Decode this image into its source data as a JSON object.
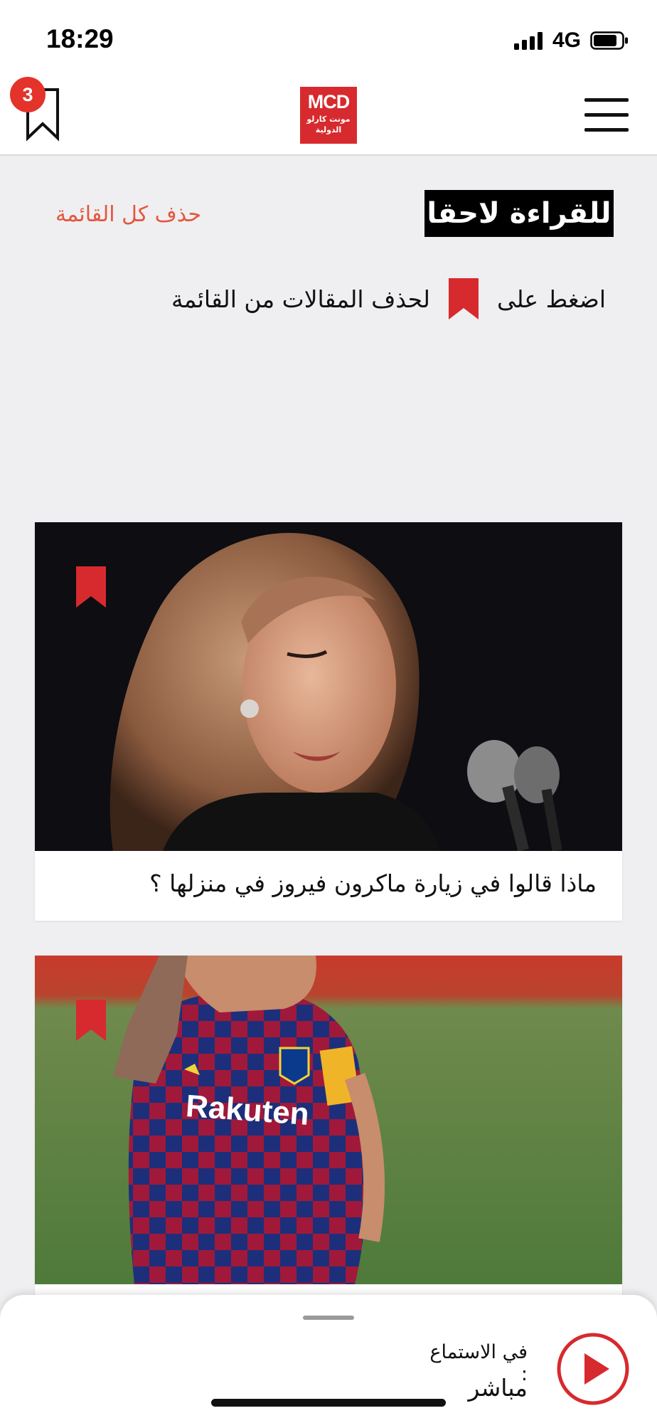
{
  "status_bar": {
    "time": "18:29",
    "network": "4G"
  },
  "header": {
    "bookmark_count": "3",
    "logo": {
      "mark": "MCD",
      "subtitle_line1": "مونت كارلو",
      "subtitle_line2": "الدولية"
    }
  },
  "page": {
    "title": "للقراءة لاحقا",
    "clear_all": "حذف كل القائمة",
    "instruction_press": "اضغط على",
    "instruction_action": "لحذف المقالات من القائمة"
  },
  "articles": [
    {
      "title": "ماذا قالوا في زيارة ماكرون فيروز في منزلها ؟"
    },
    {
      "title": ""
    }
  ],
  "player": {
    "label": "في الاستماع :",
    "status": "مباشر"
  },
  "colors": {
    "accent": "#d72a2e",
    "clear_link": "#e4573f",
    "badge": "#e4332a"
  },
  "icons": [
    "bookmark-outline-icon",
    "menu-icon",
    "bookmark-filled-icon",
    "play-icon"
  ]
}
